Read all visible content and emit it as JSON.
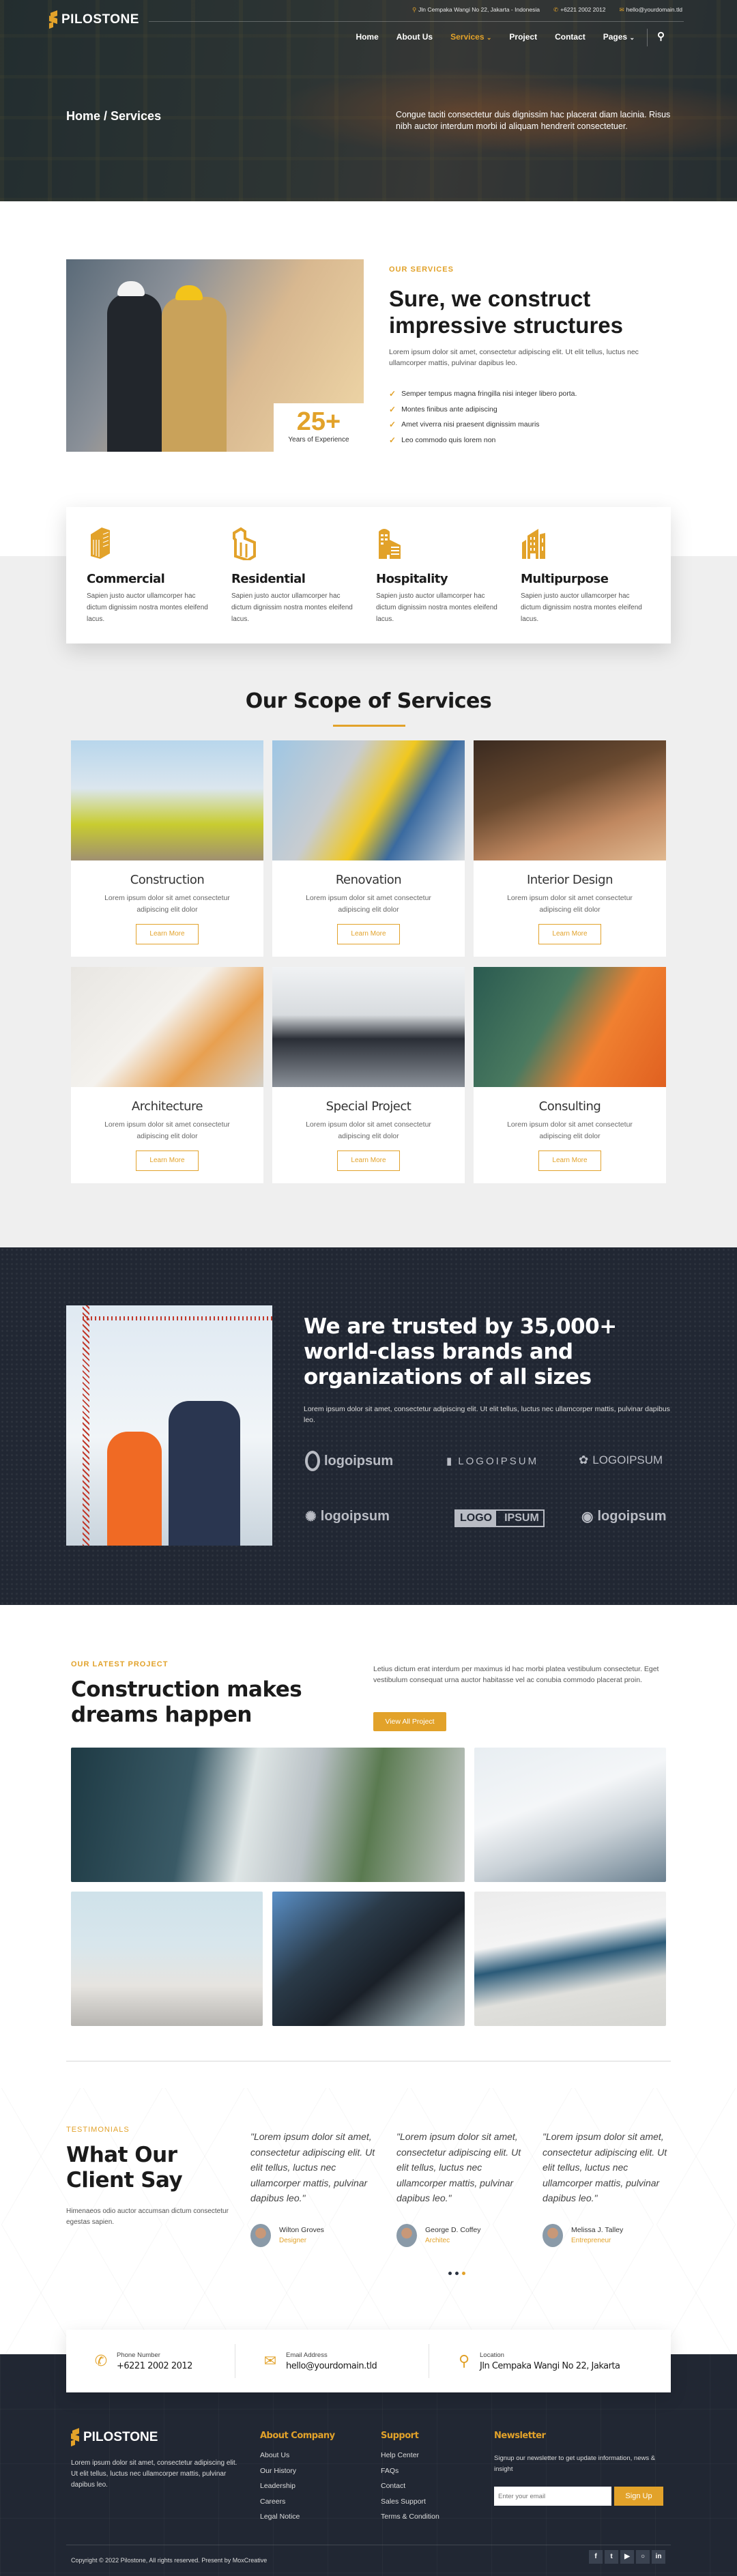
{
  "brand": {
    "name": "PILOSTONE",
    "accent": "#e2a22a",
    "dark": "#212733"
  },
  "topbar": {
    "address": "Jln Cempaka Wangi No 22, Jakarta - Indonesia",
    "phone": "+6221 2002 2012",
    "email": "hello@yourdomain.tld"
  },
  "nav": {
    "items": [
      {
        "label": "Home"
      },
      {
        "label": "About Us"
      },
      {
        "label": "Services",
        "active": true,
        "dropdown": true
      },
      {
        "label": "Project"
      },
      {
        "label": "Contact"
      },
      {
        "label": "Pages",
        "dropdown": true
      }
    ],
    "search_icon": "search-icon"
  },
  "hero": {
    "breadcrumb": "Home / Services",
    "description": "Congue taciti consectetur duis dignissim hac placerat diam lacinia. Risus nibh auctor interdum morbi id aliquam hendrerit consectetuer."
  },
  "about": {
    "experience_number": "25+",
    "experience_label": "Years of Experience",
    "eyebrow": "OUR SERVICES",
    "title": "Sure, we construct impressive structures",
    "text": "Lorem ipsum dolor sit amet, consectetur adipiscing elit. Ut elit tellus, luctus nec ullamcorper mattis, pulvinar dapibus leo.",
    "list": [
      "Semper tempus magna fringilla nisi integer libero porta.",
      "Montes finibus ante adipiscing",
      "Amet viverra nisi praesent dignissim mauris",
      "Leo commodo quis lorem non"
    ]
  },
  "categories": [
    {
      "title": "Commercial",
      "text": "Sapien justo auctor ullamcorper hac dictum dignissim nostra montes eleifend lacus.",
      "icon": "commercial-building-icon"
    },
    {
      "title": "Residential",
      "text": "Sapien justo auctor ullamcorper hac dictum dignissim nostra montes eleifend lacus.",
      "icon": "residential-house-icon"
    },
    {
      "title": "Hospitality",
      "text": "Sapien justo auctor ullamcorper hac dictum dignissim nostra montes eleifend lacus.",
      "icon": "hotel-building-icon"
    },
    {
      "title": "Multipurpose",
      "text": "Sapien justo auctor ullamcorper hac dictum dignissim nostra montes eleifend lacus.",
      "icon": "city-buildings-icon"
    }
  ],
  "scope": {
    "title": "Our Scope of Services",
    "services": [
      {
        "title": "Construction",
        "text": "Lorem ipsum dolor sit amet consectetur adipiscing elit dolor",
        "button": "Learn More"
      },
      {
        "title": "Renovation",
        "text": "Lorem ipsum dolor sit amet consectetur adipiscing elit dolor",
        "button": "Learn More"
      },
      {
        "title": "Interior Design",
        "text": "Lorem ipsum dolor sit amet consectetur adipiscing elit dolor",
        "button": "Learn More"
      },
      {
        "title": "Architecture",
        "text": "Lorem ipsum dolor sit amet consectetur adipiscing elit dolor",
        "button": "Learn More"
      },
      {
        "title": "Special Project",
        "text": "Lorem ipsum dolor sit amet consectetur adipiscing elit dolor",
        "button": "Learn More"
      },
      {
        "title": "Consulting",
        "text": "Lorem ipsum dolor sit amet consectetur adipiscing elit dolor",
        "button": "Learn More"
      }
    ]
  },
  "trust": {
    "title": "We are trusted by 35,000+ world-class brands and organizations of all sizes",
    "text": "Lorem ipsum dolor sit amet, consectetur adipiscing elit. Ut elit tellus, luctus nec ullamcorper mattis, pulvinar dapibus leo.",
    "logos": [
      "logoipsum",
      "LOGOIPSUM",
      "LOGOIPSUM",
      "logoipsum",
      "LOGO IPSUM",
      "logoipsum"
    ]
  },
  "projects": {
    "eyebrow": "OUR LATEST PROJECT",
    "title": "Construction makes dreams happen",
    "text": "Letius dictum erat interdum per maximus id hac morbi platea vestibulum consectetur. Eget vestibulum consequat urna auctor habitasse vel ac conubia commodo placerat proin.",
    "button": "View All Project"
  },
  "testimonials": {
    "eyebrow": "TESTIMONIALS",
    "title": "What Our Client Say",
    "text": "Himenaeos odio auctor accumsan dictum consectetur egestas sapien.",
    "items": [
      {
        "quote": "\"Lorem ipsum dolor sit amet, consectetur adipiscing elit. Ut elit tellus, luctus nec ullamcorper mattis, pulvinar dapibus leo.\"",
        "name": "Wilton Groves",
        "role": "Designer"
      },
      {
        "quote": "\"Lorem ipsum dolor sit amet, consectetur adipiscing elit. Ut elit tellus, luctus nec ullamcorper mattis, pulvinar dapibus leo.\"",
        "name": "George D. Coffey",
        "role": "Architec"
      },
      {
        "quote": "\"Lorem ipsum dolor sit amet, consectetur adipiscing elit. Ut elit tellus, luctus nec ullamcorper mattis, pulvinar dapibus leo.\"",
        "name": "Melissa J. Talley",
        "role": "Entrepreneur"
      }
    ],
    "pagination": {
      "total": 3,
      "active": 3
    }
  },
  "contact": {
    "phone_label": "Phone Number",
    "phone": "+6221 2002 2012",
    "email_label": "Email Address",
    "email": "hello@yourdomain.tld",
    "location_label": "Location",
    "location": "Jln Cempaka Wangi No 22, Jakarta"
  },
  "footer": {
    "about": "Lorem ipsum dolor sit amet, consectetur adipiscing elit. Ut elit tellus, luctus nec ullamcorper mattis, pulvinar dapibus leo.",
    "company_title": "About Company",
    "company_links": [
      "About Us",
      "Our History",
      "Leadership",
      "Careers",
      "Legal Notice"
    ],
    "support_title": "Support",
    "support_links": [
      "Help Center",
      "FAQs",
      "Contact",
      "Sales Support",
      "Terms & Condition"
    ],
    "newsletter_title": "Newsletter",
    "newsletter_text": "Signup our newsletter to get update information, news & insight",
    "email_placeholder": "Enter your email",
    "signup": "Sign Up",
    "copyright": "Copyright © 2022 Pilostone, All rights reserved. Present by MoxCreative",
    "social": [
      "facebook",
      "twitter",
      "youtube",
      "instagram",
      "linkedin"
    ]
  }
}
